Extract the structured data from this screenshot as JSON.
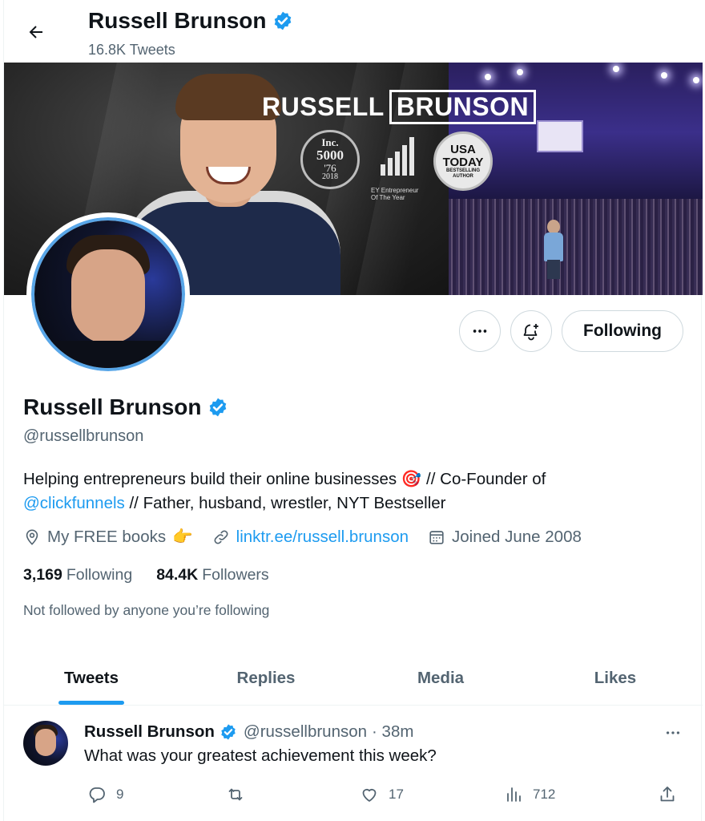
{
  "header": {
    "name": "Russell Brunson",
    "tweet_count": "16.8K Tweets"
  },
  "banner": {
    "logo_first": "RUSSELL",
    "logo_last": "BRUNSON",
    "inc_line1": "Inc.",
    "inc_line2": "5000",
    "inc_line3": "'76",
    "inc_line4": "2018",
    "ey_caption_1": "EY Entrepreneur",
    "ey_caption_2": "Of The Year",
    "usa_line1": "USA",
    "usa_line2": "TODAY",
    "usa_line3": "BESTSELLING",
    "usa_line4": "AUTHOR"
  },
  "actions": {
    "following_label": "Following"
  },
  "profile": {
    "name": "Russell Brunson",
    "handle": "@russellbrunson",
    "bio_text_1": "Helping entrepreneurs build their online businesses",
    "bio_emoji_1": "🎯",
    "bio_text_2": "// Co-Founder of",
    "bio_mention": "@clickfunnels",
    "bio_text_3": "// Father, husband, wrestler, NYT Bestseller",
    "location": "My FREE books",
    "location_emoji": "👉",
    "website": "linktr.ee/russell.brunson",
    "joined": "Joined June 2008",
    "following_count": "3,169",
    "following_label": "Following",
    "followers_count": "84.4K",
    "followers_label": "Followers",
    "followed_by_note": "Not followed by anyone you’re following"
  },
  "tabs": [
    {
      "label": "Tweets",
      "active": true
    },
    {
      "label": "Replies",
      "active": false
    },
    {
      "label": "Media",
      "active": false
    },
    {
      "label": "Likes",
      "active": false
    }
  ],
  "tweet": {
    "author_name": "Russell Brunson",
    "author_handle": "@russellbrunson",
    "time": "· 38m",
    "text": "What was your greatest achievement this week?",
    "reply_count": "9",
    "like_count": "17",
    "view_count": "712"
  },
  "colors": {
    "accent": "#1d9bf0",
    "muted": "#536471",
    "verified": "#1d9bf0",
    "border": "#cfd9de"
  },
  "icons": {
    "back": "arrow-left-icon",
    "verified": "verified-badge-icon",
    "more": "more-horizontal-icon",
    "notify": "bell-plus-icon",
    "location": "location-pin-icon",
    "link": "link-icon",
    "calendar": "calendar-icon",
    "reply": "reply-icon",
    "retweet": "retweet-icon",
    "like": "heart-icon",
    "views": "analytics-icon",
    "share": "share-icon"
  }
}
